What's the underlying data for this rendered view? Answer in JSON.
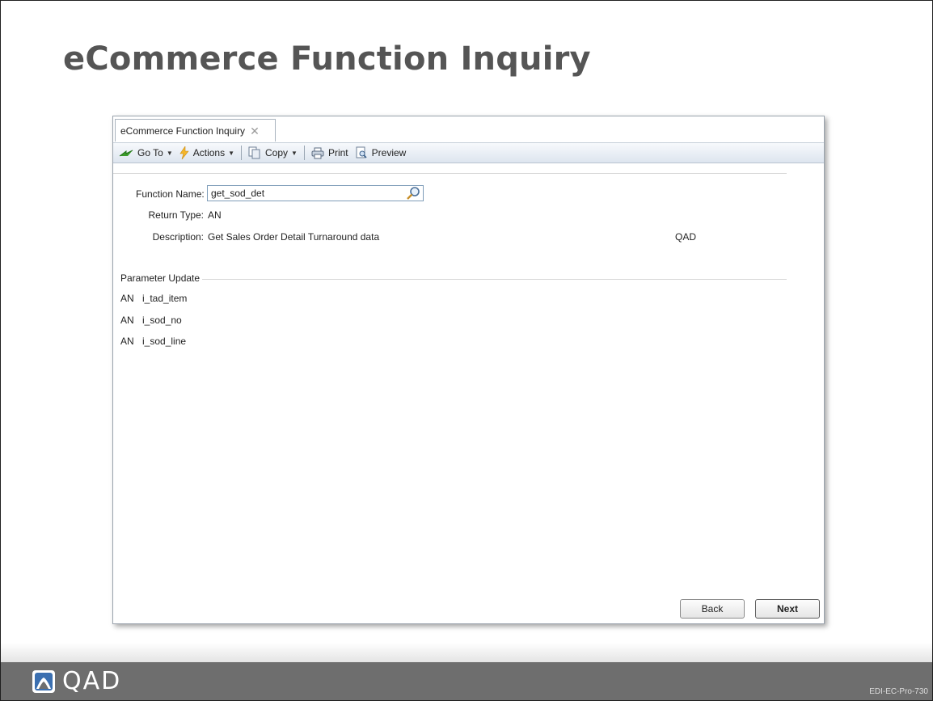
{
  "slide": {
    "title": "eCommerce Function Inquiry",
    "footer_code": "EDI-EC-Pro-730",
    "logo_text": "QAD"
  },
  "window": {
    "tab_label": "eCommerce Function Inquiry",
    "toolbar": {
      "goto": "Go To",
      "actions": "Actions",
      "copy": "Copy",
      "print": "Print",
      "preview": "Preview"
    },
    "form": {
      "function_name_label": "Function Name:",
      "function_name_value": "get_sod_det",
      "return_type_label": "Return Type:",
      "return_type_value": "AN",
      "description_label": "Description:",
      "description_value": "Get Sales Order Detail Turnaround data",
      "owner_value": "QAD"
    },
    "parameters": {
      "section_title": "Parameter Update",
      "rows": [
        {
          "type": "AN",
          "name": "i_tad_item"
        },
        {
          "type": "AN",
          "name": "i_sod_no"
        },
        {
          "type": "AN",
          "name": "i_sod_line"
        }
      ]
    },
    "buttons": {
      "back": "Back",
      "next": "Next"
    }
  },
  "colors": {
    "title": "#555555",
    "footer": "#6e6e6e",
    "logo_icon": "#3b6fb0"
  },
  "icons": {
    "goto": "goto-arrow-icon",
    "actions": "lightning-icon",
    "copy": "copy-icon",
    "print": "printer-icon",
    "preview": "preview-icon",
    "lookup": "magnifier-icon",
    "close": "close-icon",
    "logo": "qad-logo-icon"
  }
}
